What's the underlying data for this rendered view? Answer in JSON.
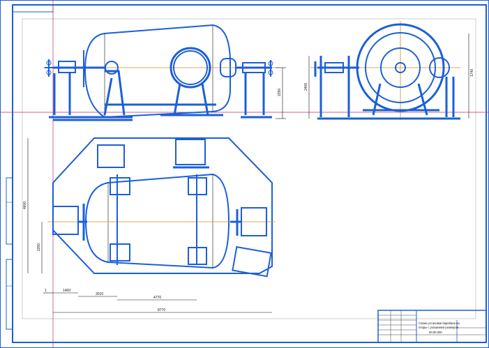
{
  "dimensions": {
    "front_height_right": "2250",
    "side_height_left": "2400",
    "side_height_right": "1740",
    "plan_total_height": "4600",
    "plan_left_offset": "2200",
    "plan_dim_1": "1",
    "plan_dim_2": "1400",
    "plan_dim_3": "3010",
    "plan_dim_4": "4770",
    "plan_total_width": "8770"
  },
  "title_block": {
    "title_line_1": "Схема установки барабана на",
    "title_line_2": "опоры с указанием размеров",
    "doc_code": "00.00.000"
  },
  "colors": {
    "part_lines": "#1b5fd8",
    "axis_lines": "#d08a1a",
    "crosshair": "#b0306a",
    "frame": "#1b5fd8"
  }
}
